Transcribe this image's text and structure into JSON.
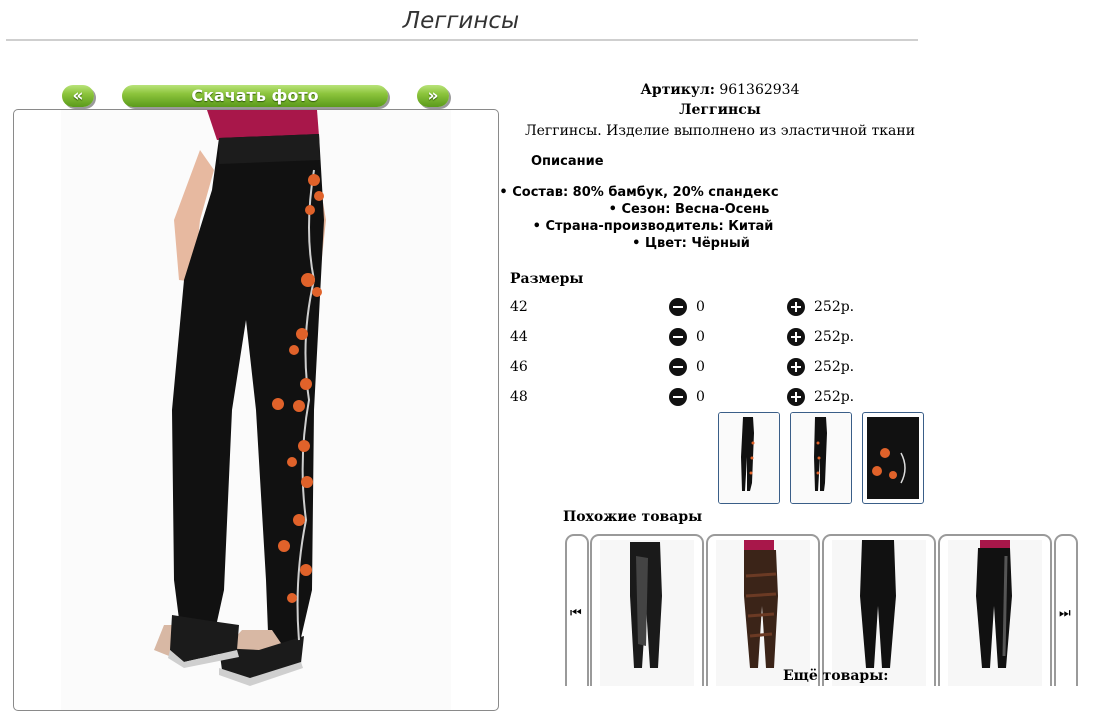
{
  "title": "Леггинсы",
  "nav": {
    "prev": "«",
    "download": "Скачать фото",
    "next": "»"
  },
  "product": {
    "article_label": "Артикул:",
    "article_value": "961362934",
    "name": "Леггинсы",
    "short_desc": "Леггинсы. Изделие выполнено из эластичной ткани"
  },
  "description": {
    "title": "Описание",
    "specs": [
      "Состав: 80% бамбук, 20% спандекс",
      "Сезон: Весна-Осень",
      "Страна-производитель: Китай",
      "Цвет: Чёрный"
    ]
  },
  "sizes": {
    "title": "Размеры",
    "rows": [
      {
        "size": "42",
        "qty": "0",
        "price": "252р."
      },
      {
        "size": "44",
        "qty": "0",
        "price": "252р."
      },
      {
        "size": "46",
        "qty": "0",
        "price": "252р."
      },
      {
        "size": "48",
        "qty": "0",
        "price": "252р."
      }
    ]
  },
  "similar": {
    "title": "Похожие товары"
  },
  "more": {
    "title": "Ещё товары:"
  },
  "colors": {
    "accent_green": "#6aa826",
    "legging": "#111111",
    "top": "#a8174a",
    "flower": "#e0622a",
    "thumb_border": "#3a5e88"
  },
  "icons": {
    "minus": "minus-circle-icon",
    "plus": "plus-circle-icon",
    "carousel_prev": "skip-previous-icon",
    "carousel_next": "skip-next-icon"
  }
}
